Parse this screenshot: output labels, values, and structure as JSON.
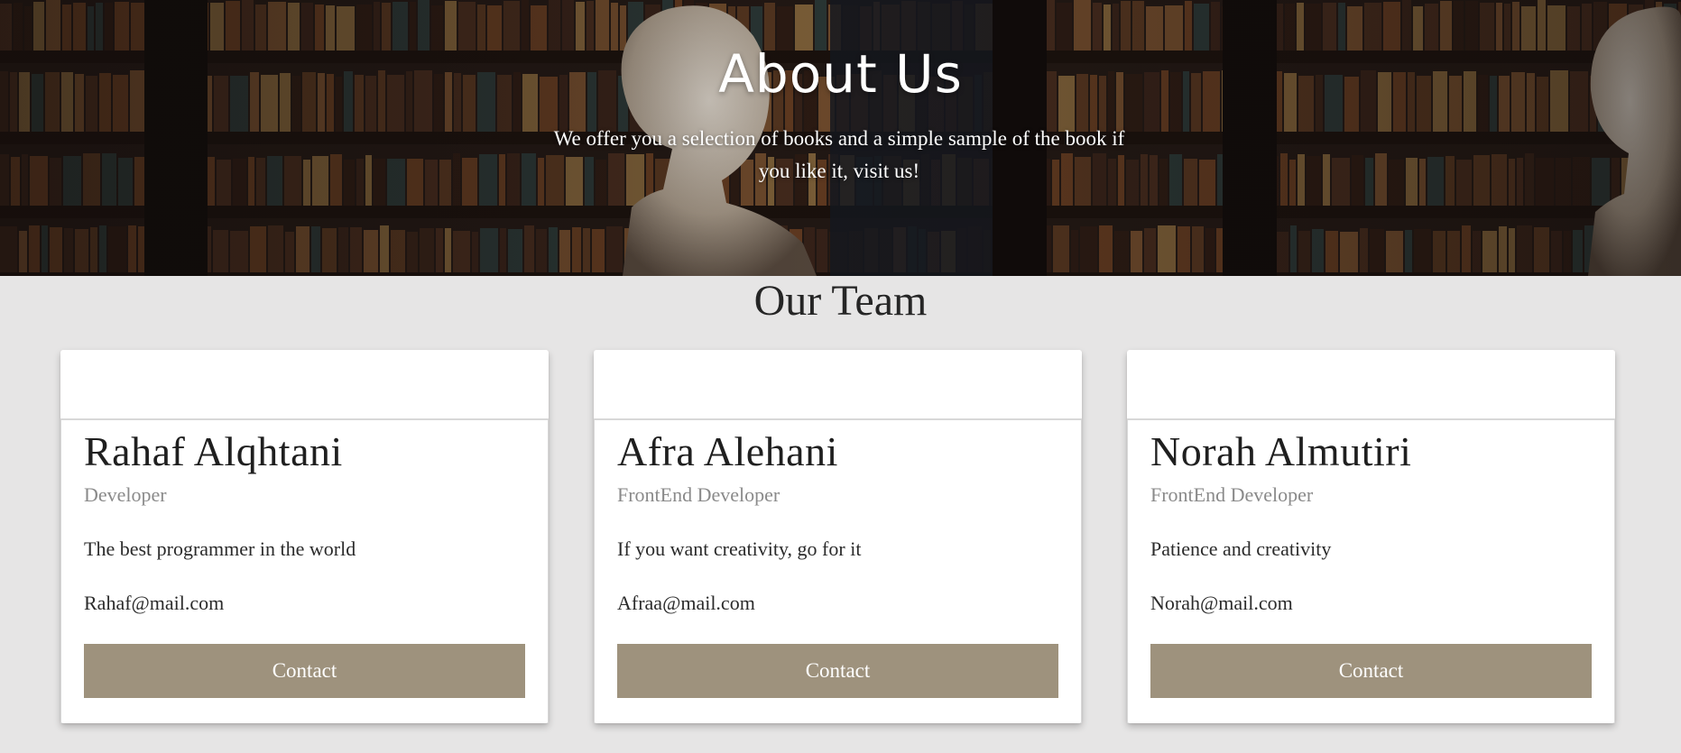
{
  "hero": {
    "title": "About Us",
    "subtitle": "We offer you a selection of books and a simple sample of the book if you like it, visit us!"
  },
  "team": {
    "heading": "Our Team",
    "accent_color": "#9e927d",
    "members": [
      {
        "name": "Rahaf Alqhtani",
        "role": "Developer",
        "description": "The best programmer in the world",
        "email": "Rahaf@mail.com",
        "button_label": "Contact"
      },
      {
        "name": "Afra Alehani",
        "role": "FrontEnd Developer",
        "description": "If you want creativity, go for it",
        "email": "Afraa@mail.com",
        "button_label": "Contact"
      },
      {
        "name": "Norah Almutiri",
        "role": "FrontEnd Developer",
        "description": "Patience and creativity",
        "email": "Norah@mail.com",
        "button_label": "Contact"
      }
    ]
  }
}
